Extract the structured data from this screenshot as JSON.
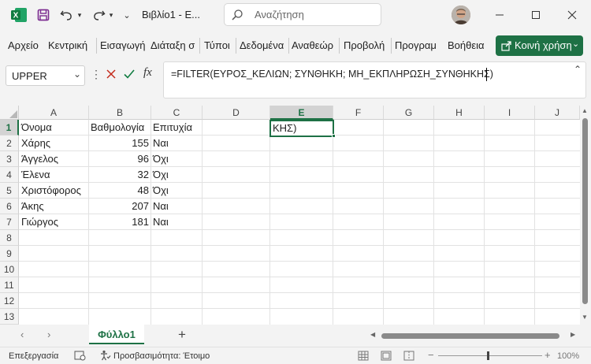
{
  "title": {
    "app_icon": "excel-icon",
    "file_name": "Βιβλίο1 - Ε...",
    "search_placeholder": "Αναζήτηση",
    "save_icon": "save-icon",
    "undo_icon": "undo-icon",
    "redo_icon": "redo-icon"
  },
  "ribbon": {
    "tabs": [
      "Αρχείο",
      "Κεντρική",
      "Εισαγωγή",
      "Διάταξη σ",
      "Τύποι",
      "Δεδομένα",
      "Αναθεώρ",
      "Προβολή",
      "Προγραμ",
      "Βοήθεια"
    ],
    "share_label": "Κοινή χρήση",
    "accent": "#1e7145"
  },
  "formula_bar": {
    "name_box": "UPPER",
    "fx_label": "fx",
    "formula": "=FILTER(ΕΥΡΟΣ_ΚΕΛΙΩΝ; ΣΥΝΘΗΚΗ; ΜΗ_ΕΚΠΛΗΡΩΣΗ_ΣΥΝΘΗΚΗΣ)"
  },
  "grid": {
    "columns": [
      "A",
      "B",
      "C",
      "D",
      "E",
      "F",
      "G",
      "H",
      "I",
      "J"
    ],
    "rows": [
      "1",
      "2",
      "3",
      "4",
      "5",
      "6",
      "7",
      "8",
      "9",
      "10",
      "11",
      "12",
      "13"
    ],
    "header_row": [
      "Όνομα",
      "Βαθμολογία",
      "Επιτυχία"
    ],
    "data": [
      [
        "Χάρης",
        "155",
        "Ναι"
      ],
      [
        "Άγγελος",
        "96",
        "Όχι"
      ],
      [
        "Έλενα",
        "32",
        "Όχι"
      ],
      [
        "Χριστόφορος",
        "48",
        "Όχι"
      ],
      [
        "Άκης",
        "207",
        "Ναι"
      ],
      [
        "Γιώργος",
        "181",
        "Ναι"
      ]
    ],
    "active_cell": "E1",
    "active_cell_text": "ΚΗΣ)"
  },
  "sheets": {
    "active": "Φύλλο1",
    "add_label": "+"
  },
  "status": {
    "mode": "Επεξεργασία",
    "accessibility": "Προσβασιμότητα: Έτοιμο",
    "zoom": "100%"
  }
}
